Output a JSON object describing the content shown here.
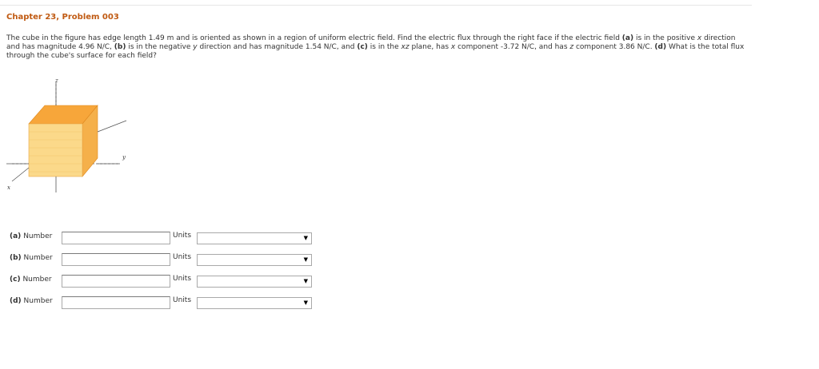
{
  "header": {
    "title": "Chapter 23, Problem 003"
  },
  "problem": {
    "s1": "The cube in the figure has edge length 1.49 m and is oriented as shown in a region of uniform electric field. Find the electric flux through the right face if the electric field ",
    "a_mark": "(a)",
    "s2": " is in the positive ",
    "x1": "x",
    "s3": " direction and has magnitude 4.96 N/C, ",
    "b_mark": "(b)",
    "s4": " is in the negative ",
    "y1": "y",
    "s5": " direction and has magnitude 1.54 N/C, and ",
    "c_mark": "(c)",
    "s6": " is in the ",
    "xz": "xz",
    "s7": " plane, has ",
    "x2": "x",
    "s8": " component -3.72 N/C, and has ",
    "z1": "z",
    "s9": " component 3.86 N/C. ",
    "d_mark": "(d)",
    "s10": " What is the total flux through the cube's surface for each field?"
  },
  "figure": {
    "axis_z": "z",
    "axis_y": "y",
    "axis_x": "x",
    "colors": {
      "front": "#fbd98a",
      "top": "#f7a63a",
      "side": "#f5b04a"
    }
  },
  "answers": [
    {
      "mark": "(a)",
      "label": "Number",
      "value": "",
      "units_label": "Units",
      "units_value": ""
    },
    {
      "mark": "(b)",
      "label": "Number",
      "value": "",
      "units_label": "Units",
      "units_value": ""
    },
    {
      "mark": "(c)",
      "label": "Number",
      "value": "",
      "units_label": "Units",
      "units_value": ""
    },
    {
      "mark": "(d)",
      "label": "Number",
      "value": "",
      "units_label": "Units",
      "units_value": ""
    }
  ]
}
